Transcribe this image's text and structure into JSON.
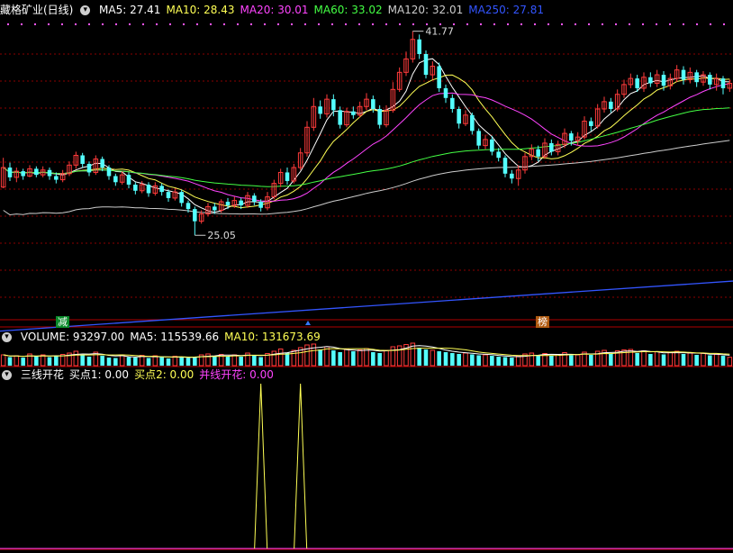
{
  "price_header": {
    "stock": "藏格矿业(日线)",
    "ma_items": [
      {
        "text": "MA5: 27.41",
        "color": "#ffffff"
      },
      {
        "text": "MA10: 28.43",
        "color": "#ffff55"
      },
      {
        "text": "MA20: 30.01",
        "color": "#ff44ff"
      },
      {
        "text": "MA60: 33.02",
        "color": "#44ff44"
      },
      {
        "text": "MA120: 32.01",
        "color": "#cccccc"
      },
      {
        "text": "MA250: 27.81",
        "color": "#3355ff"
      }
    ]
  },
  "volume_header": {
    "items": [
      {
        "text": "VOLUME: 93297.00",
        "color": "#ffffff"
      },
      {
        "text": "MA5: 115539.66",
        "color": "#ffffff"
      },
      {
        "text": "MA10: 131673.69",
        "color": "#ffff55"
      }
    ]
  },
  "indicator_header": {
    "items": [
      {
        "text": "三线开花",
        "color": "#ffffff"
      },
      {
        "text": "买点1: 0.00",
        "color": "#ffffff"
      },
      {
        "text": "买点2: 0.00",
        "color": "#ffff55"
      },
      {
        "text": "并线开花: 0.00",
        "color": "#ff44ff"
      }
    ]
  },
  "tags": [
    {
      "text": "减",
      "color": "#ffffff",
      "bg": "#0a8a2a"
    },
    {
      "text": "榜",
      "color": "#ffffff",
      "bg": "#b05a10"
    }
  ],
  "colors": {
    "up": "#ff3b3b",
    "down": "#54ffff",
    "grid": "#8b0000",
    "separator": "#b00000"
  },
  "chart_data": {
    "type": "candlestick",
    "price_ylim": [
      18.5,
      43.0
    ],
    "volume_ylim": [
      0,
      260000
    ],
    "high_label": "41.77",
    "low_label": "25.05",
    "candles": [
      [
        29,
        30.6,
        28.9,
        31.4
      ],
      [
        30.6,
        29.8,
        29.5,
        31
      ],
      [
        29.8,
        30.3,
        29.4,
        30.6
      ],
      [
        30.3,
        29.9,
        29.6,
        30.5
      ],
      [
        29.9,
        30.5,
        29.8,
        30.8
      ],
      [
        30.5,
        30,
        29.8,
        30.7
      ],
      [
        30,
        30.4,
        29.8,
        30.7
      ],
      [
        30.4,
        29.9,
        29.6,
        30.6
      ],
      [
        29.9,
        29.6,
        29.3,
        30.2
      ],
      [
        29.6,
        30.1,
        29.4,
        30.4
      ],
      [
        30.1,
        30.8,
        29.9,
        31.1
      ],
      [
        30.8,
        31.6,
        30.5,
        31.9
      ],
      [
        31.6,
        30.9,
        30.6,
        31.8
      ],
      [
        30.9,
        30.2,
        29.9,
        31.1
      ],
      [
        30.2,
        31.3,
        30,
        31.6
      ],
      [
        31.3,
        30.6,
        30.3,
        31.5
      ],
      [
        30.6,
        29.9,
        29.6,
        30.8
      ],
      [
        29.9,
        29.4,
        29.1,
        30.1
      ],
      [
        29.4,
        30,
        29.2,
        30.3
      ],
      [
        30,
        29.2,
        28.9,
        30.2
      ],
      [
        29.2,
        28.7,
        28.4,
        29.4
      ],
      [
        28.7,
        29.2,
        28.5,
        29.5
      ],
      [
        29.2,
        28.5,
        28.2,
        29.4
      ],
      [
        28.5,
        29.1,
        28.3,
        29.4
      ],
      [
        29.1,
        28.6,
        28.3,
        29.3
      ],
      [
        28.6,
        28.1,
        27.8,
        28.8
      ],
      [
        28.1,
        28.6,
        27.9,
        28.9
      ],
      [
        28.6,
        27.7,
        27.4,
        28.8
      ],
      [
        27.7,
        27.2,
        26.9,
        27.9
      ],
      [
        27.2,
        26.2,
        25.05,
        27.4
      ],
      [
        26.2,
        26.8,
        26,
        27.1
      ],
      [
        26.8,
        27.4,
        26.6,
        27.7
      ],
      [
        27.4,
        27.1,
        26.8,
        27.7
      ],
      [
        27.1,
        27.8,
        26.9,
        28
      ],
      [
        27.8,
        27.5,
        27.2,
        28.1
      ],
      [
        27.5,
        27.9,
        27.3,
        28.2
      ],
      [
        27.9,
        27.5,
        27.2,
        28.1
      ],
      [
        27.5,
        28.3,
        27.3,
        28.6
      ],
      [
        28.3,
        27.8,
        27.5,
        28.5
      ],
      [
        27.8,
        27.3,
        27,
        28
      ],
      [
        27.3,
        28.2,
        27.1,
        28.6
      ],
      [
        28.2,
        29.3,
        28,
        29.6
      ],
      [
        29.3,
        30.2,
        29,
        30.5
      ],
      [
        30.2,
        29.5,
        29.2,
        30.6
      ],
      [
        29.5,
        30.6,
        29.3,
        30.9
      ],
      [
        30.6,
        31.8,
        30.4,
        32.2
      ],
      [
        31.8,
        33.9,
        31.5,
        34.4
      ],
      [
        33.9,
        35.6,
        33.6,
        36.3
      ],
      [
        35.6,
        35,
        34.6,
        36.1
      ],
      [
        35,
        36.2,
        34.7,
        36.6
      ],
      [
        36.2,
        35.3,
        34.8,
        36.6
      ],
      [
        35.3,
        34.1,
        33.8,
        35.6
      ],
      [
        34.1,
        35.2,
        33.9,
        35.5
      ],
      [
        35.2,
        34.9,
        34.6,
        35.6
      ],
      [
        34.9,
        35.6,
        34.7,
        36
      ],
      [
        35.6,
        36.2,
        35.3,
        36.7
      ],
      [
        36.2,
        35.4,
        35.1,
        36.5
      ],
      [
        35.4,
        34.1,
        33.8,
        35.7
      ],
      [
        34.1,
        35.3,
        33.9,
        35.7
      ],
      [
        35.3,
        37,
        35.1,
        37.6
      ],
      [
        37,
        38.4,
        36.8,
        38.8
      ],
      [
        38.4,
        39.5,
        38.1,
        40.1
      ],
      [
        39.5,
        41.1,
        39.2,
        41.77
      ],
      [
        41.1,
        39.9,
        39.5,
        41.5
      ],
      [
        39.9,
        38.2,
        37.9,
        40.2
      ],
      [
        38.2,
        38.9,
        37.8,
        39.3
      ],
      [
        38.9,
        37.1,
        36.8,
        39.2
      ],
      [
        37.1,
        36.3,
        35.9,
        37.4
      ],
      [
        36.3,
        35.4,
        35.1,
        36.6
      ],
      [
        35.4,
        34.2,
        33.8,
        35.6
      ],
      [
        34.2,
        34.9,
        34,
        35.3
      ],
      [
        34.9,
        33.6,
        33.3,
        35.1
      ],
      [
        33.6,
        32.4,
        32.1,
        33.8
      ],
      [
        32.4,
        32.9,
        32.1,
        33.3
      ],
      [
        32.9,
        31.9,
        31.6,
        33.2
      ],
      [
        31.9,
        31.4,
        31.1,
        32.2
      ],
      [
        31.4,
        30.1,
        29.8,
        31.6
      ],
      [
        30.1,
        29.7,
        29.3,
        30.4
      ],
      [
        29.7,
        30.4,
        29.1,
        30.8
      ],
      [
        30.4,
        31.5,
        30.1,
        31.8
      ],
      [
        31.5,
        32.1,
        31.2,
        32.5
      ],
      [
        32.1,
        31.5,
        31.1,
        32.4
      ],
      [
        31.5,
        32.6,
        31.3,
        33
      ],
      [
        32.6,
        31.9,
        31.6,
        32.9
      ],
      [
        31.9,
        32.5,
        31.6,
        32.8
      ],
      [
        32.5,
        33.4,
        32.2,
        33.8
      ],
      [
        33.4,
        32.8,
        32.4,
        33.6
      ],
      [
        32.8,
        33.1,
        32.4,
        33.5
      ],
      [
        33.1,
        34.4,
        32.9,
        34.8
      ],
      [
        34.4,
        34,
        33.6,
        34.7
      ],
      [
        34,
        35.4,
        33.8,
        35.8
      ],
      [
        35.4,
        36,
        35.1,
        36.4
      ],
      [
        36,
        35.4,
        35.1,
        36.3
      ],
      [
        35.4,
        36.6,
        35.2,
        37
      ],
      [
        36.6,
        37.4,
        36.3,
        37.8
      ],
      [
        37.4,
        37.9,
        37.1,
        38.3
      ],
      [
        37.9,
        37.1,
        36.8,
        38.2
      ],
      [
        37.1,
        38,
        36.8,
        38.4
      ],
      [
        38,
        37.5,
        37.2,
        38.4
      ],
      [
        37.5,
        38.2,
        37.2,
        38.6
      ],
      [
        38.2,
        37.3,
        36.9,
        38.5
      ],
      [
        37.3,
        37.9,
        37,
        38.3
      ],
      [
        37.9,
        38.6,
        37.6,
        39
      ],
      [
        38.6,
        37.8,
        37.4,
        38.9
      ],
      [
        37.8,
        38.4,
        37.5,
        38.8
      ],
      [
        38.4,
        37.6,
        37.2,
        38.6
      ],
      [
        37.6,
        38.2,
        37.3,
        38.5
      ],
      [
        38.2,
        37.4,
        37,
        38.4
      ],
      [
        37.4,
        37.9,
        36.9,
        38.3
      ],
      [
        37.9,
        37.1,
        36.6,
        38.1
      ],
      [
        37.1,
        37.5,
        36.8,
        37.8
      ]
    ],
    "volumes": [
      120000,
      95000,
      110000,
      90000,
      130000,
      100000,
      120000,
      95000,
      105000,
      125000,
      140000,
      160000,
      120000,
      100000,
      150000,
      110000,
      90000,
      85000,
      120000,
      95000,
      90000,
      115000,
      85000,
      110000,
      95000,
      80000,
      105000,
      90000,
      85000,
      100000,
      120000,
      130000,
      110000,
      125000,
      105000,
      120000,
      100000,
      140000,
      110000,
      95000,
      135000,
      160000,
      185000,
      145000,
      170000,
      200000,
      230000,
      240000,
      180000,
      210000,
      170000,
      150000,
      180000,
      160000,
      175000,
      190000,
      150000,
      140000,
      170000,
      210000,
      220000,
      235000,
      250000,
      200000,
      180000,
      170000,
      160000,
      150000,
      140000,
      130000,
      140000,
      125000,
      115000,
      120000,
      110000,
      100000,
      95000,
      90000,
      105000,
      130000,
      140000,
      115000,
      135000,
      110000,
      125000,
      145000,
      115000,
      120000,
      150000,
      120000,
      160000,
      170000,
      130000,
      165000,
      175000,
      180000,
      140000,
      165000,
      130000,
      155000,
      125000,
      150000,
      160000,
      130000,
      140000,
      120000,
      135000,
      115000,
      125000,
      110000,
      93297
    ],
    "ma250_range": [
      17.2,
      21.3
    ],
    "indicator": {
      "name": "三线开花",
      "spikes": [
        {
          "index": 39,
          "value": 1
        },
        {
          "index": 45,
          "value": 1
        }
      ],
      "ylim": [
        0,
        1
      ]
    }
  }
}
